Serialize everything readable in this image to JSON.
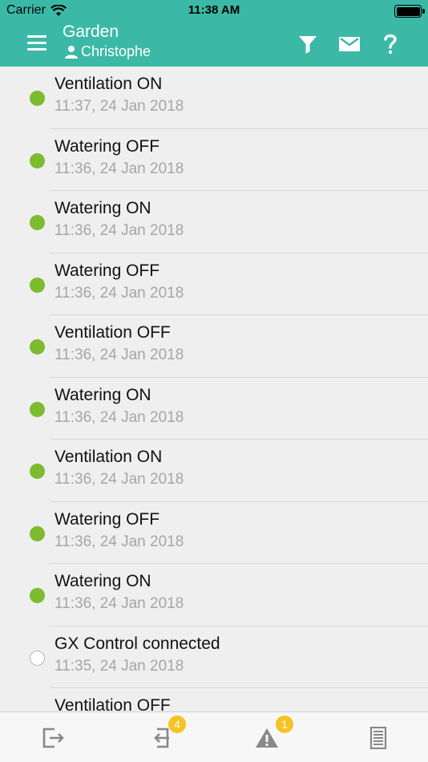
{
  "status_bar": {
    "carrier": "Carrier",
    "time": "11:38 AM"
  },
  "header": {
    "title": "Garden",
    "user": "Christophe",
    "actions": [
      "filter-icon",
      "mail-icon",
      "help-icon"
    ]
  },
  "events": [
    {
      "title": "Ventilation ON",
      "time": "11:37, 24 Jan 2018",
      "state": "on"
    },
    {
      "title": "Watering OFF",
      "time": "11:36, 24 Jan 2018",
      "state": "on"
    },
    {
      "title": "Watering ON",
      "time": "11:36, 24 Jan 2018",
      "state": "on"
    },
    {
      "title": "Watering OFF",
      "time": "11:36, 24 Jan 2018",
      "state": "on"
    },
    {
      "title": "Ventilation OFF",
      "time": "11:36, 24 Jan 2018",
      "state": "on"
    },
    {
      "title": "Watering ON",
      "time": "11:36, 24 Jan 2018",
      "state": "on"
    },
    {
      "title": "Ventilation ON",
      "time": "11:36, 24 Jan 2018",
      "state": "on"
    },
    {
      "title": "Watering OFF",
      "time": "11:36, 24 Jan 2018",
      "state": "on"
    },
    {
      "title": "Watering ON",
      "time": "11:36, 24 Jan 2018",
      "state": "on"
    },
    {
      "title": "GX Control connected",
      "time": "11:35, 24 Jan 2018",
      "state": "off"
    },
    {
      "title": "Ventilation OFF",
      "time": "",
      "state": "off"
    }
  ],
  "tabs": [
    {
      "name": "tab-outgoing",
      "icon": "exit-icon",
      "badge": ""
    },
    {
      "name": "tab-incoming",
      "icon": "enter-icon",
      "badge": "4"
    },
    {
      "name": "tab-alerts",
      "icon": "warning-icon",
      "badge": "1"
    },
    {
      "name": "tab-log",
      "icon": "log-icon",
      "badge": ""
    }
  ],
  "colors": {
    "header": "#3bb9a6",
    "status_on": "#7dbb2f",
    "badge": "#f6c224"
  }
}
